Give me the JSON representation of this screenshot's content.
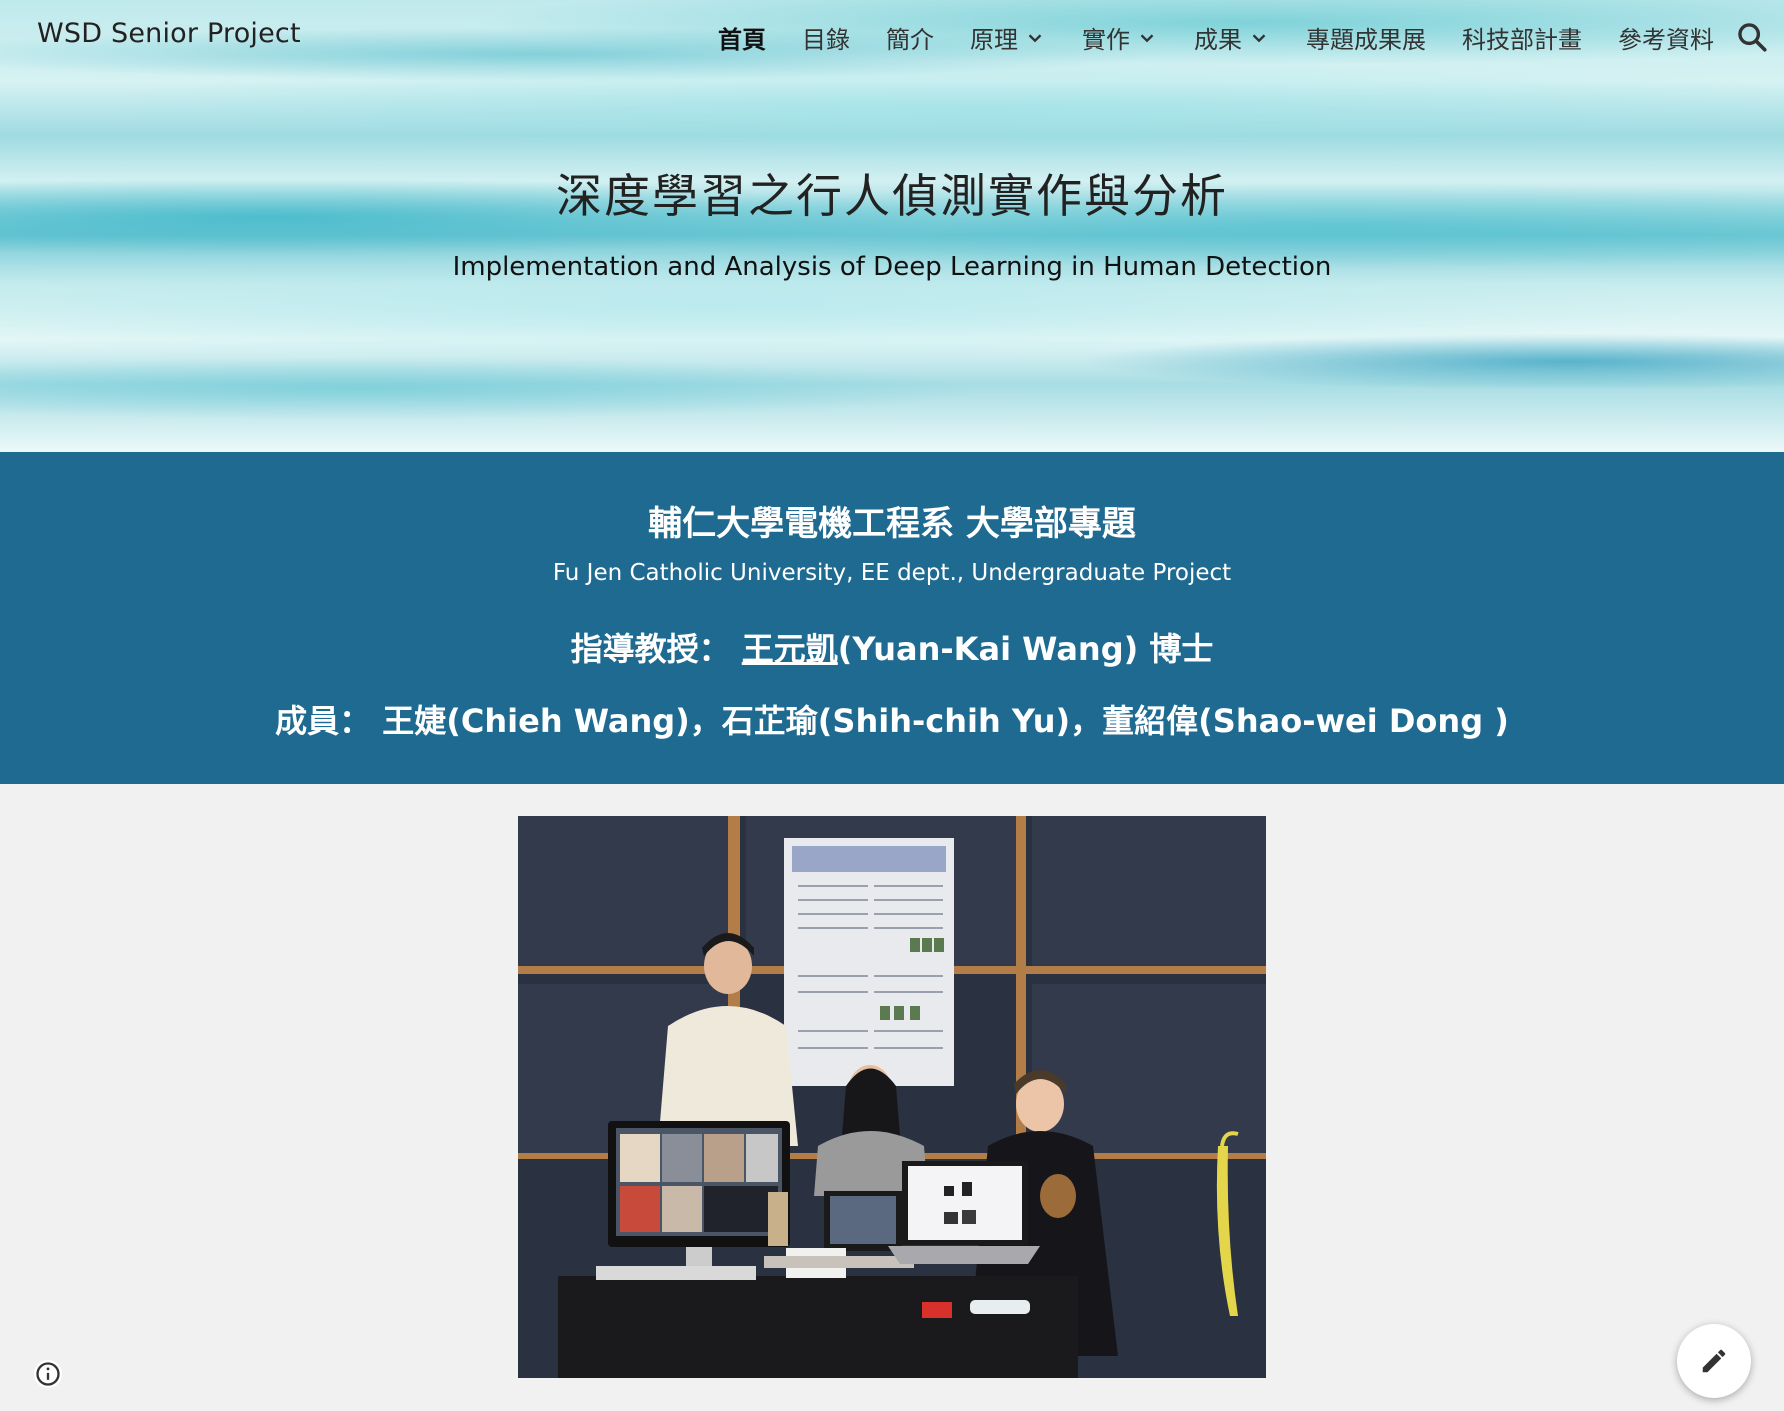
{
  "site": {
    "title": "WSD Senior Project"
  },
  "nav": {
    "items": [
      {
        "label": "首頁",
        "active": true,
        "dropdown": false
      },
      {
        "label": "目錄",
        "active": false,
        "dropdown": false
      },
      {
        "label": "簡介",
        "active": false,
        "dropdown": false
      },
      {
        "label": "原理",
        "active": false,
        "dropdown": true
      },
      {
        "label": "實作",
        "active": false,
        "dropdown": true
      },
      {
        "label": "成果",
        "active": false,
        "dropdown": true
      },
      {
        "label": "專題成果展",
        "active": false,
        "dropdown": false
      },
      {
        "label": "科技部計畫",
        "active": false,
        "dropdown": false
      },
      {
        "label": "參考資料",
        "active": false,
        "dropdown": false
      }
    ],
    "search_icon": "search-icon"
  },
  "hero": {
    "title": "深度學習之行人偵測實作與分析",
    "subtitle": "Implementation and Analysis of Deep Learning in Human Detection"
  },
  "band": {
    "title": "輔仁大學電機工程系 大學部專題",
    "english": "Fu Jen Catholic University, EE dept., Undergraduate Project",
    "advisor_prefix": "指導教授： ",
    "advisor_link": "王元凱",
    "advisor_suffix": "(Yuan-Kai Wang) 博士",
    "members": "成員： 王婕(Chieh Wang)，石芷瑜(Shih-chih Yu)，董紹偉(Shao-wei Dong )",
    "color": "#1f6a91"
  },
  "photo": {
    "alt_icon": "team-photo"
  },
  "controls": {
    "info_icon": "info-icon",
    "edit_icon": "pencil-icon"
  }
}
